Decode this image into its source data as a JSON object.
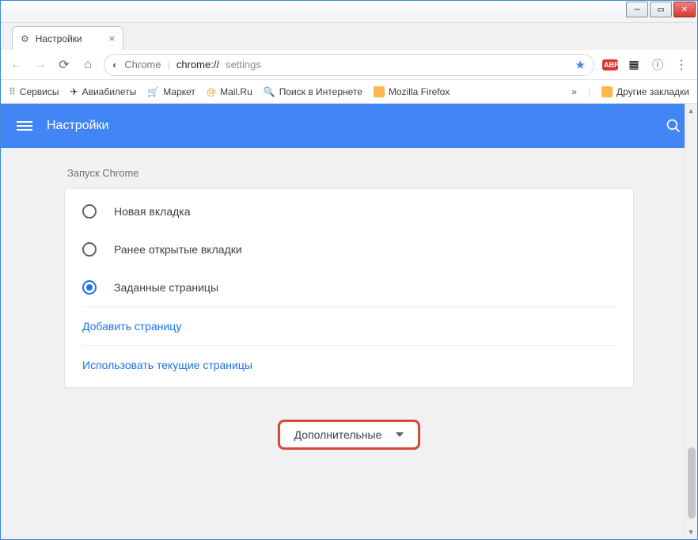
{
  "window": {
    "tab_title": "Настройки"
  },
  "urlbar": {
    "scheme_label": "Chrome",
    "host": "chrome://",
    "path": "settings"
  },
  "bookmarks": {
    "items": [
      "Сервисы",
      "Авиабилеты",
      "Маркет",
      "Mail.Ru",
      "Поиск в Интернете",
      "Mozilla Firefox"
    ],
    "overflow": "»",
    "other": "Другие закладки"
  },
  "header": {
    "title": "Настройки"
  },
  "section": {
    "label": "Запуск Chrome",
    "options": [
      {
        "label": "Новая вкладка",
        "selected": false
      },
      {
        "label": "Ранее открытые вкладки",
        "selected": false
      },
      {
        "label": "Заданные страницы",
        "selected": true
      }
    ],
    "links": [
      "Добавить страницу",
      "Использовать текущие страницы"
    ]
  },
  "advanced": {
    "label": "Дополнительные"
  }
}
